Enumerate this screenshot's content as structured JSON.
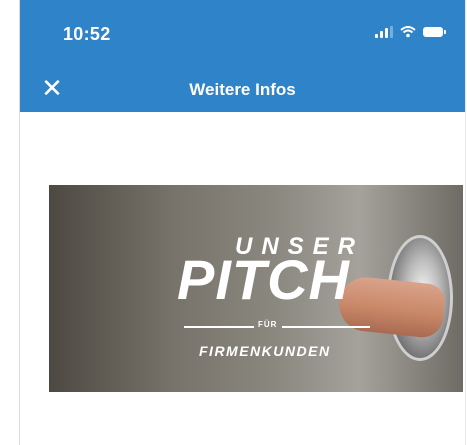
{
  "status_bar": {
    "time": "10:52",
    "icons": [
      "signal-icon",
      "wifi-icon",
      "battery-icon"
    ]
  },
  "navbar": {
    "title": "Weitere Infos",
    "close_icon": "close-icon"
  },
  "video": {
    "headline_top": "UNSER",
    "headline_main": "PITCH",
    "headline_small": "FÜR",
    "headline_bottom": "FIRMENKUNDEN"
  },
  "colors": {
    "header": "#2f83c9",
    "text_on_header": "#ffffff"
  }
}
